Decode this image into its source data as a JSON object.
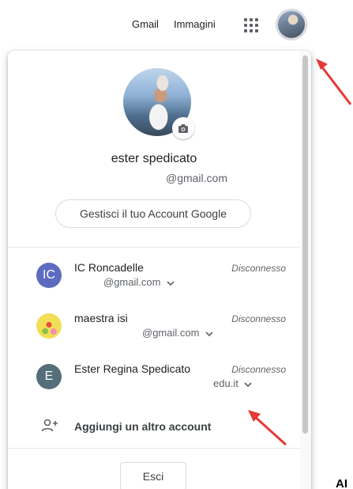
{
  "header": {
    "gmail_label": "Gmail",
    "images_label": "Immagini",
    "apps_icon": "apps-grid-icon"
  },
  "profile": {
    "name": "ester spedicato",
    "email": "@gmail.com",
    "manage_label": "Gestisci il tuo Account Google"
  },
  "accounts": [
    {
      "initial": "IC",
      "name": "IC Roncadelle",
      "email": "@gmail.com",
      "status": "Disconnesso",
      "avatar_color": "#5c6bc0"
    },
    {
      "initial": "",
      "name": "maestra isi",
      "email": "@gmail.com",
      "status": "Disconnesso",
      "avatar_color": "#e8d24a"
    },
    {
      "initial": "E",
      "name": "Ester Regina Spedicato",
      "email": "edu.it",
      "status": "Disconnesso",
      "avatar_color": "#546e7a"
    }
  ],
  "add_account_label": "Aggiungi un altro account",
  "signout_label": "Esci",
  "corner_text": "AI",
  "colors": {
    "arrow": "#e53935",
    "accent": "#1a73e8"
  }
}
